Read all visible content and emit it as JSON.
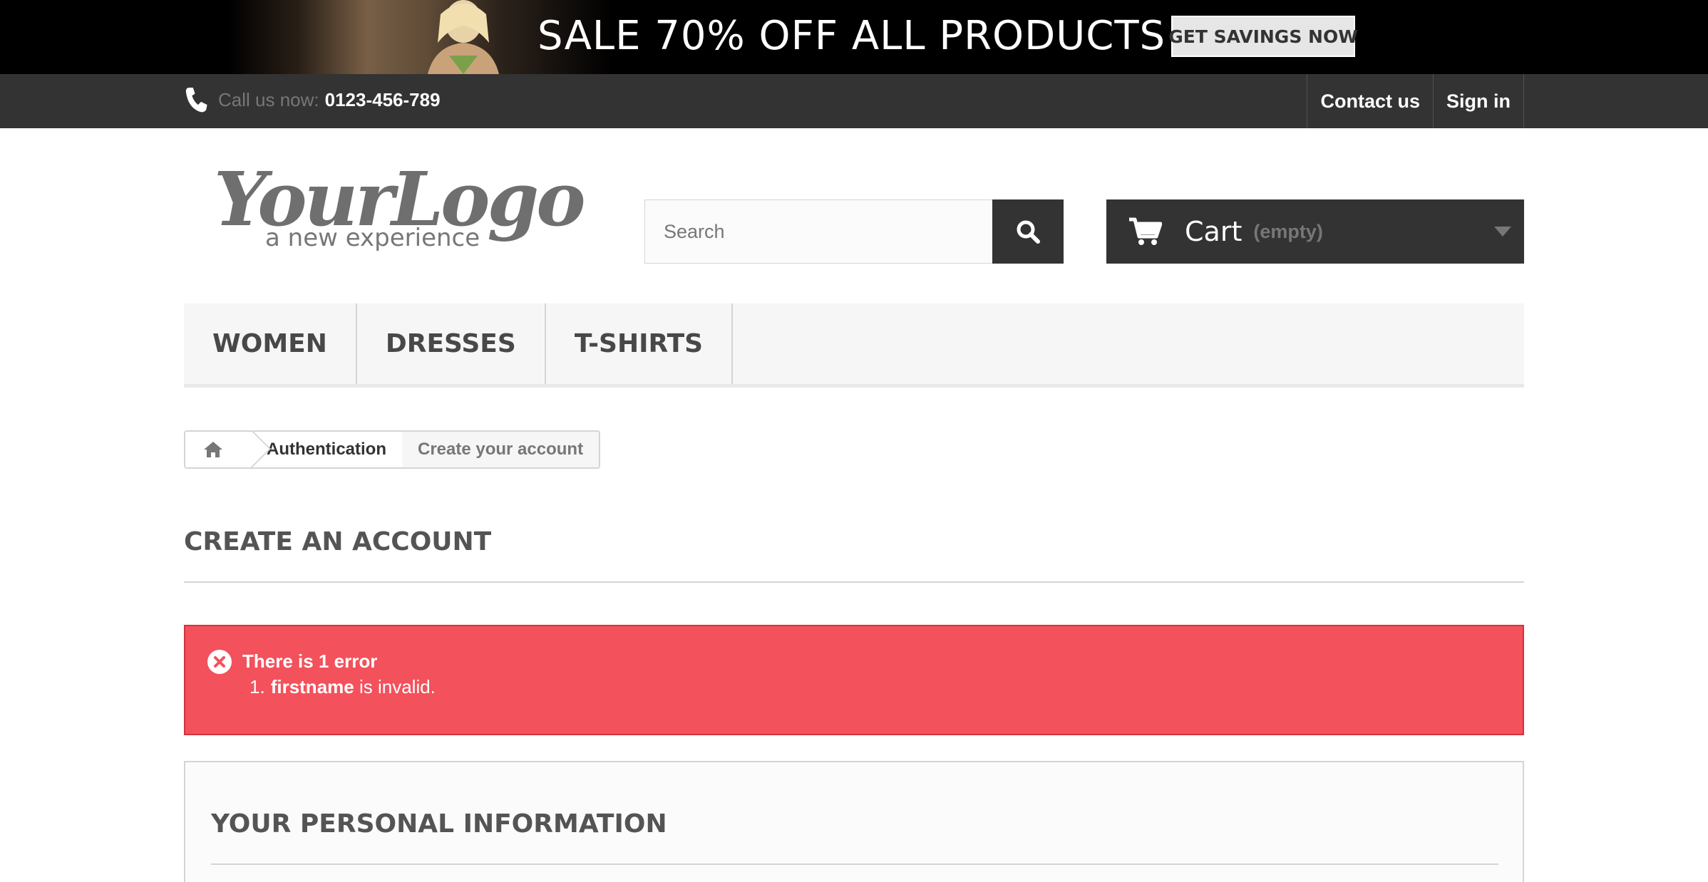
{
  "banner": {
    "headline": "SALE 70% OFF ALL PRODUCTS",
    "cta_label": "GET SAVINGS NOW"
  },
  "topbar": {
    "call_label": "Call us now:",
    "call_number": "0123-456-789",
    "links": [
      "Contact us",
      "Sign in"
    ]
  },
  "header": {
    "logo_script": "YourLogo",
    "logo_tagline": "a new experience",
    "search_placeholder": "Search",
    "cart_title": "Cart",
    "cart_status": "(empty)"
  },
  "menu": {
    "items": [
      "WOMEN",
      "DRESSES",
      "T-SHIRTS"
    ]
  },
  "breadcrumb": {
    "items": [
      "Authentication"
    ],
    "current": "Create your account"
  },
  "page": {
    "title": "CREATE AN ACCOUNT"
  },
  "alert": {
    "heading": "There is 1 error",
    "errors": [
      {
        "num": "1.",
        "field": "firstname",
        "message": "is invalid."
      }
    ]
  },
  "section": {
    "title": "YOUR PERSONAL INFORMATION"
  },
  "colors": {
    "accent_dark": "#333333",
    "error": "#f3515c",
    "banner": "#000000"
  }
}
